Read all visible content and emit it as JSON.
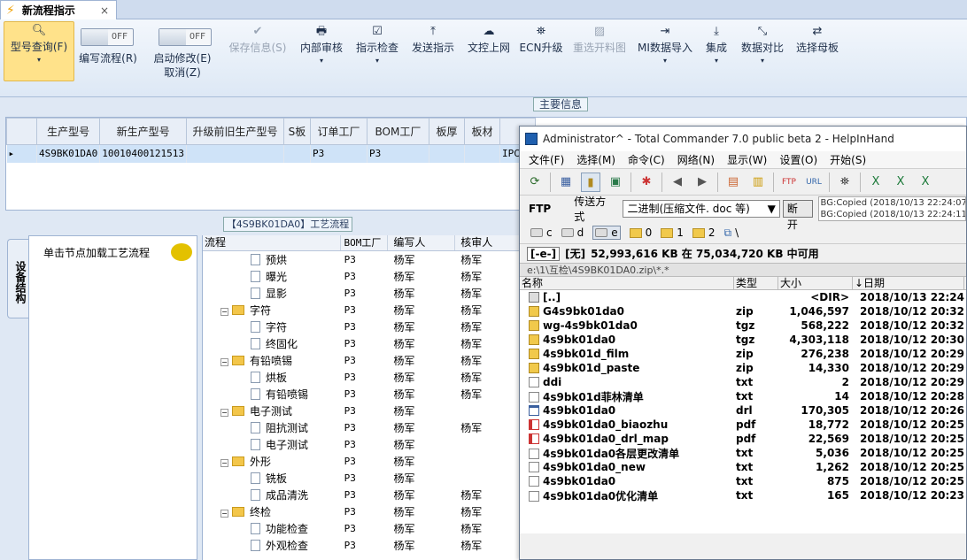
{
  "tab": {
    "title": "新流程指示",
    "close": "×"
  },
  "ribbon": {
    "model_query": "型号查询(F)",
    "edit_flow": "编写流程(R)",
    "edit_flow_toggle": "OFF",
    "enable_modify": "启动修改(E)",
    "enable_modify_toggle": "OFF",
    "cancel": "取消(Z)",
    "save_info": "保存信息(S)",
    "internal_review": "内部审核",
    "instruction_check": "指示检查",
    "send_instruction": "发送指示",
    "doc_upload": "文控上网",
    "ecn_upgrade": "ECN升级",
    "reselect_drawing": "重选开料图",
    "mi_import": "MI数据导入",
    "integrate": "集成",
    "data_compare": "数据对比",
    "select_master": "选择母板"
  },
  "main_info": {
    "title": "主要信息",
    "columns": [
      "生产型号",
      "新生产型号",
      "升级前旧生产型号",
      "S板",
      "订单工厂",
      "BOM工厂",
      "板厚",
      "板材"
    ],
    "row": [
      "4S9BK01DA0",
      "10010400121513",
      "",
      "",
      "P3",
      "P3",
      "",
      "",
      "IPC"
    ]
  },
  "process": {
    "title": "【4S9BK01DA0】工艺流程",
    "side_tab": "设备结构",
    "hint": "单击节点加载工艺流程",
    "headers": [
      "流程",
      "BOM工厂",
      "编写人",
      "核审人"
    ],
    "rows": [
      {
        "name": "预烘",
        "type": "leaf",
        "bom": "P3",
        "writer": "杨军",
        "reviewer": "杨军"
      },
      {
        "name": "曝光",
        "type": "leaf",
        "bom": "P3",
        "writer": "杨军",
        "reviewer": "杨军"
      },
      {
        "name": "显影",
        "type": "leaf",
        "bom": "P3",
        "writer": "杨军",
        "reviewer": "杨军"
      },
      {
        "name": "字符",
        "type": "group",
        "bom": "P3",
        "writer": "杨军",
        "reviewer": "杨军"
      },
      {
        "name": "字符",
        "type": "leaf",
        "bom": "P3",
        "writer": "杨军",
        "reviewer": "杨军"
      },
      {
        "name": "终固化",
        "type": "leaf",
        "bom": "P3",
        "writer": "杨军",
        "reviewer": "杨军"
      },
      {
        "name": "有铅喷锡",
        "type": "group",
        "bom": "P3",
        "writer": "杨军",
        "reviewer": "杨军"
      },
      {
        "name": "烘板",
        "type": "leaf",
        "bom": "P3",
        "writer": "杨军",
        "reviewer": "杨军"
      },
      {
        "name": "有铅喷锡",
        "type": "leaf",
        "bom": "P3",
        "writer": "杨军",
        "reviewer": "杨军"
      },
      {
        "name": "电子测试",
        "type": "group",
        "bom": "P3",
        "writer": "杨军",
        "reviewer": ""
      },
      {
        "name": "阻抗测试",
        "type": "leaf",
        "bom": "P3",
        "writer": "杨军",
        "reviewer": "杨军"
      },
      {
        "name": "电子测试",
        "type": "leaf",
        "bom": "P3",
        "writer": "杨军",
        "reviewer": ""
      },
      {
        "name": "外形",
        "type": "group",
        "bom": "P3",
        "writer": "杨军",
        "reviewer": ""
      },
      {
        "name": "铣板",
        "type": "leaf",
        "bom": "P3",
        "writer": "杨军",
        "reviewer": ""
      },
      {
        "name": "成品清洗",
        "type": "leaf",
        "bom": "P3",
        "writer": "杨军",
        "reviewer": "杨军"
      },
      {
        "name": "终检",
        "type": "group",
        "bom": "P3",
        "writer": "杨军",
        "reviewer": "杨军"
      },
      {
        "name": "功能检查",
        "type": "leaf",
        "bom": "P3",
        "writer": "杨军",
        "reviewer": "杨军"
      },
      {
        "name": "外观检查",
        "type": "leaf",
        "bom": "P3",
        "writer": "杨军",
        "reviewer": "杨军"
      }
    ]
  },
  "tc": {
    "title": "Administrator^ - Total Commander 7.0 public beta 2 - HelpInHand",
    "menu": [
      "文件(F)",
      "选择(M)",
      "命令(C)",
      "网络(N)",
      "显示(W)",
      "设置(O)",
      "开始(S)"
    ],
    "ftp_label": "FTP",
    "transfer_label": "传送方式",
    "transfer_mode": "二进制(压缩文件. doc 等)",
    "disconnect": "断开",
    "log1": "BG:Copied (2018/10/13 22:24:07):",
    "log2": "BG:Copied (2018/10/13 22:24:11):",
    "drives": [
      "c",
      "d",
      "e",
      "0",
      "1",
      "2",
      "\\"
    ],
    "drive_select": "[-e-]",
    "disk_label": "[无]",
    "disk_free": "52,993,616 KB 在 75,034,720 KB 中可用",
    "path": "e:\\1\\互检\\4S9BK01DA0.zip\\*.*",
    "headers": [
      "名称",
      "类型",
      "大小",
      "↓日期"
    ],
    "files": [
      {
        "name": "[..]",
        "type": "",
        "size": "<DIR>",
        "date": "2018/10/13 22:24",
        "icon": "up"
      },
      {
        "name": "G4s9bk01da0",
        "type": "zip",
        "size": "1,046,597",
        "date": "2018/10/12 20:32",
        "icon": "zip"
      },
      {
        "name": "wg-4s9bk01da0",
        "type": "tgz",
        "size": "568,222",
        "date": "2018/10/12 20:32",
        "icon": "zip"
      },
      {
        "name": "4s9bk01da0",
        "type": "tgz",
        "size": "4,303,118",
        "date": "2018/10/12 20:30",
        "icon": "zip"
      },
      {
        "name": "4s9bk01d_film",
        "type": "zip",
        "size": "276,238",
        "date": "2018/10/12 20:29",
        "icon": "zip"
      },
      {
        "name": "4s9bk01d_paste",
        "type": "zip",
        "size": "14,330",
        "date": "2018/10/12 20:29",
        "icon": "zip"
      },
      {
        "name": "ddi",
        "type": "txt",
        "size": "2",
        "date": "2018/10/12 20:29",
        "icon": "txt"
      },
      {
        "name": "4s9bk01d菲林清单",
        "type": "txt",
        "size": "14",
        "date": "2018/10/12 20:28",
        "icon": "txt"
      },
      {
        "name": "4s9bk01da0",
        "type": "drl",
        "size": "170,305",
        "date": "2018/10/12 20:26",
        "icon": "drl"
      },
      {
        "name": "4s9bk01da0_biaozhu",
        "type": "pdf",
        "size": "18,772",
        "date": "2018/10/12 20:25",
        "icon": "pdf"
      },
      {
        "name": "4s9bk01da0_drl_map",
        "type": "pdf",
        "size": "22,569",
        "date": "2018/10/12 20:25",
        "icon": "pdf"
      },
      {
        "name": "4s9bk01da0各层更改清单",
        "type": "txt",
        "size": "5,036",
        "date": "2018/10/12 20:25",
        "icon": "txt"
      },
      {
        "name": "4s9bk01da0_new",
        "type": "txt",
        "size": "1,262",
        "date": "2018/10/12 20:25",
        "icon": "txt"
      },
      {
        "name": "4s9bk01da0",
        "type": "txt",
        "size": "875",
        "date": "2018/10/12 20:25",
        "icon": "txt"
      },
      {
        "name": "4s9bk01da0优化清单",
        "type": "txt",
        "size": "165",
        "date": "2018/10/12 20:23",
        "icon": "txt"
      }
    ]
  }
}
